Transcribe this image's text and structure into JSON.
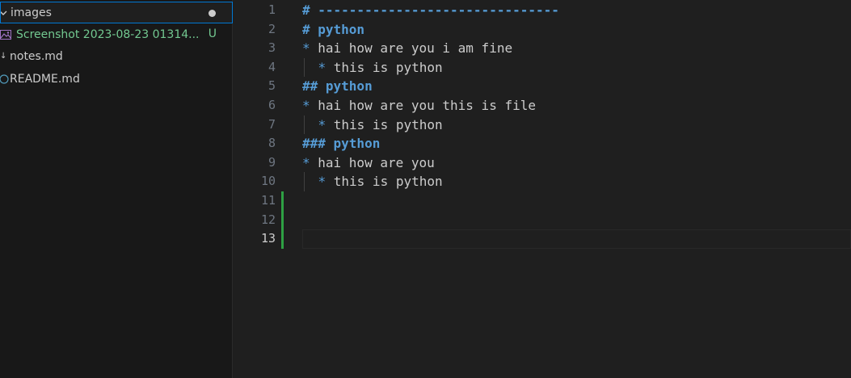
{
  "explorer": {
    "folder": {
      "label": "images",
      "modified": true
    },
    "files": [
      {
        "label": "Screenshot 2023-08-23 01314...",
        "badge": "U",
        "icon": "image-icon"
      },
      {
        "label": "notes.md",
        "icon": "markdown-icon"
      },
      {
        "label": "README.md",
        "icon": "info-icon"
      }
    ]
  },
  "editor": {
    "current_line": 13,
    "lines": [
      {
        "n": "1",
        "text": "# -------------------------------"
      },
      {
        "n": "2",
        "text": "# python"
      },
      {
        "n": "3",
        "text": "hai how are you i am fine"
      },
      {
        "n": "4",
        "text": "this is python"
      },
      {
        "n": "5",
        "text": "## python"
      },
      {
        "n": "6",
        "text": "hai how are you this is file"
      },
      {
        "n": "7",
        "text": "this is python"
      },
      {
        "n": "8",
        "text": "### python"
      },
      {
        "n": "9",
        "text": "hai how are you"
      },
      {
        "n": "10",
        "text": "this is python"
      },
      {
        "n": "11",
        "text": ""
      },
      {
        "n": "12",
        "text": ""
      },
      {
        "n": "13",
        "text": ""
      }
    ],
    "bullet_marker": "* "
  },
  "colors": {
    "heading": "#569cd6",
    "text": "#cccccc",
    "git_added": "#2ea043",
    "untracked": "#73c991",
    "selection_border": "#0078d4"
  }
}
